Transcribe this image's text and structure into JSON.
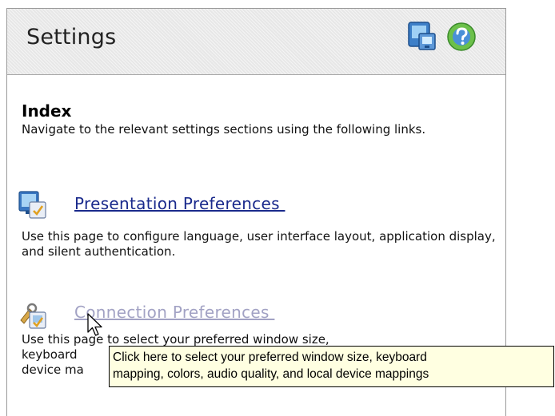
{
  "header": {
    "title": "Settings",
    "icons": [
      "desktop-icon",
      "help-icon"
    ]
  },
  "index": {
    "title": "Index",
    "description": "Navigate to the relevant settings sections using the following links."
  },
  "sections": [
    {
      "icon": "presentation-monitor-icon",
      "link_label": "Presentation Preferences ",
      "description": "Use this page to configure language, user interface layout, application display, and silent authentication."
    },
    {
      "icon": "connection-tools-icon",
      "link_label": "Connection Preferences ",
      "description_line1": "Use this page to select your preferred window size,",
      "description_line2_start": "keyboard",
      "description_line3_start": "device ma"
    }
  ],
  "tooltip": {
    "line1": "Click here to select your preferred window size, keyboard",
    "line2": "mapping, colors, audio quality, and local device mappings"
  },
  "colors": {
    "link": "#1a2a8c",
    "link_hover": "#a2a2c4",
    "tooltip_bg": "#ffffe1",
    "header_bg": "#e7e7e7"
  }
}
